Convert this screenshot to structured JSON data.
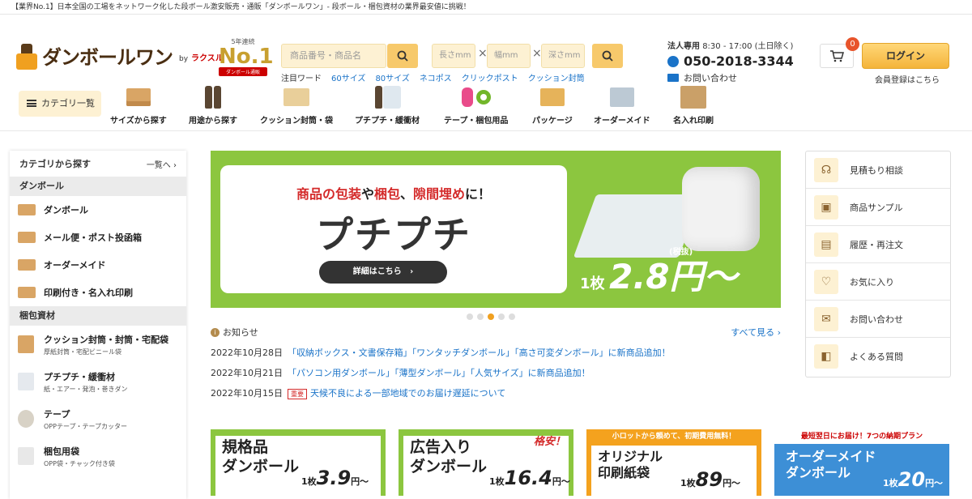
{
  "topbar": {
    "text": "【業界No.1】日本全国の工場をネットワーク化した段ボール激安販売・通販「ダンボールワン」‐ 段ボール・梱包資材の業界最安値に挑戦！"
  },
  "header": {
    "logo_text": "ダンボールワン",
    "logo_by": "by",
    "logo_brand": "ラクスル",
    "award_line1": "5年連続",
    "award_no": "No.1",
    "award_line2": "ダンボール通販",
    "search_placeholder": "商品番号・商品名",
    "dim_placeholders": [
      "長さmm",
      "幅mm",
      "深さmm"
    ],
    "times_glyph": "×",
    "keyword_label": "注目ワード",
    "keywords": [
      "60サイズ",
      "80サイズ",
      "ネコポス",
      "クリックポスト",
      "クッション封筒"
    ],
    "contact": {
      "label": "法人専用",
      "hours": "8:30 - 17:00 (土日除く)",
      "phone": "050-2018-3344",
      "inquiry": "お問い合わせ"
    },
    "cart_count": "0",
    "login_label": "ログイン",
    "register_label": "会員登録はこちら"
  },
  "catnav": {
    "menu_label": "カテゴリ一覧",
    "items": [
      "サイズから探す",
      "用途から探す",
      "クッション封筒・袋",
      "プチプチ・緩衝材",
      "テープ・梱包用品",
      "パッケージ",
      "オーダーメイド",
      "名入れ印刷"
    ]
  },
  "sidebar": {
    "title": "カテゴリから探す",
    "all_link": "一覧へ",
    "section1": "ダンボール",
    "items1": [
      "ダンボール",
      "メール便・ポスト投函箱",
      "オーダーメイド",
      "印刷付き・名入れ印刷"
    ],
    "section2": "梱包資材",
    "items2": [
      {
        "title": "クッション封筒・封筒・宅配袋",
        "sub": "厚紙封筒・宅配ビニール袋"
      },
      {
        "title": "プチプチ・緩衝材",
        "sub": "紙・エアー・発泡・巻きダン"
      },
      {
        "title": "テープ",
        "sub": "OPPテープ・テープカッター"
      },
      {
        "title": "梱包用袋",
        "sub": "OPP袋・チャック付き袋"
      }
    ]
  },
  "hero": {
    "title_red1": "商品の包装",
    "title_mid1": "や",
    "title_red2": "梱包",
    "title_mid2": "、",
    "title_red3": "隙間埋め",
    "title_end": "に！",
    "big": "プチプチ",
    "button": "詳細はこちら",
    "price_prefix": "1枚",
    "price": "2.8円〜",
    "tax": "(税抜)"
  },
  "carousel": {
    "count": 5,
    "active": 3
  },
  "news": {
    "heading": "お知らせ",
    "more": "すべて見る",
    "items": [
      {
        "date": "2022年10月28日",
        "badge": "",
        "text": "「収納ボックス・文書保存箱」「ワンタッチダンボール」「高さ可変ダンボール」に新商品追加！"
      },
      {
        "date": "2022年10月21日",
        "badge": "",
        "text": "「パソコン用ダンボール」「薄型ダンボール」「人気サイズ」に新商品追加！"
      },
      {
        "date": "2022年10月15日",
        "badge": "重要",
        "text": "天候不良による一部地域でのお届け遅延について"
      }
    ]
  },
  "promos": [
    {
      "strip": "",
      "title": "規格品\nダンボール",
      "prefix": "1枚",
      "price": "3.9",
      "suffix": "円〜",
      "tag": ""
    },
    {
      "strip": "",
      "title": "広告入り\nダンボール",
      "prefix": "1枚",
      "price": "16.4",
      "suffix": "円〜",
      "tag": "格安！"
    },
    {
      "strip": "小ロットから頼めて、初期費用無料！",
      "title": "オリジナル\n印刷紙袋",
      "prefix": "1枚",
      "price": "89",
      "suffix": "円〜",
      "tag": ""
    },
    {
      "strip": "最短翌日にお届け！7つの納期プラン",
      "title": "オーダーメイド\nダンボール",
      "prefix": "1枚",
      "price": "20",
      "suffix": "円〜",
      "tag": ""
    }
  ],
  "right_menu": [
    "見積もり相談",
    "商品サンプル",
    "履歴・再注文",
    "お気に入り",
    "お問い合わせ",
    "よくある質問"
  ],
  "colors": {
    "accent": "#f4b43a",
    "green": "#8cc63f",
    "link": "#1a73c8",
    "red": "#d42a2a"
  }
}
